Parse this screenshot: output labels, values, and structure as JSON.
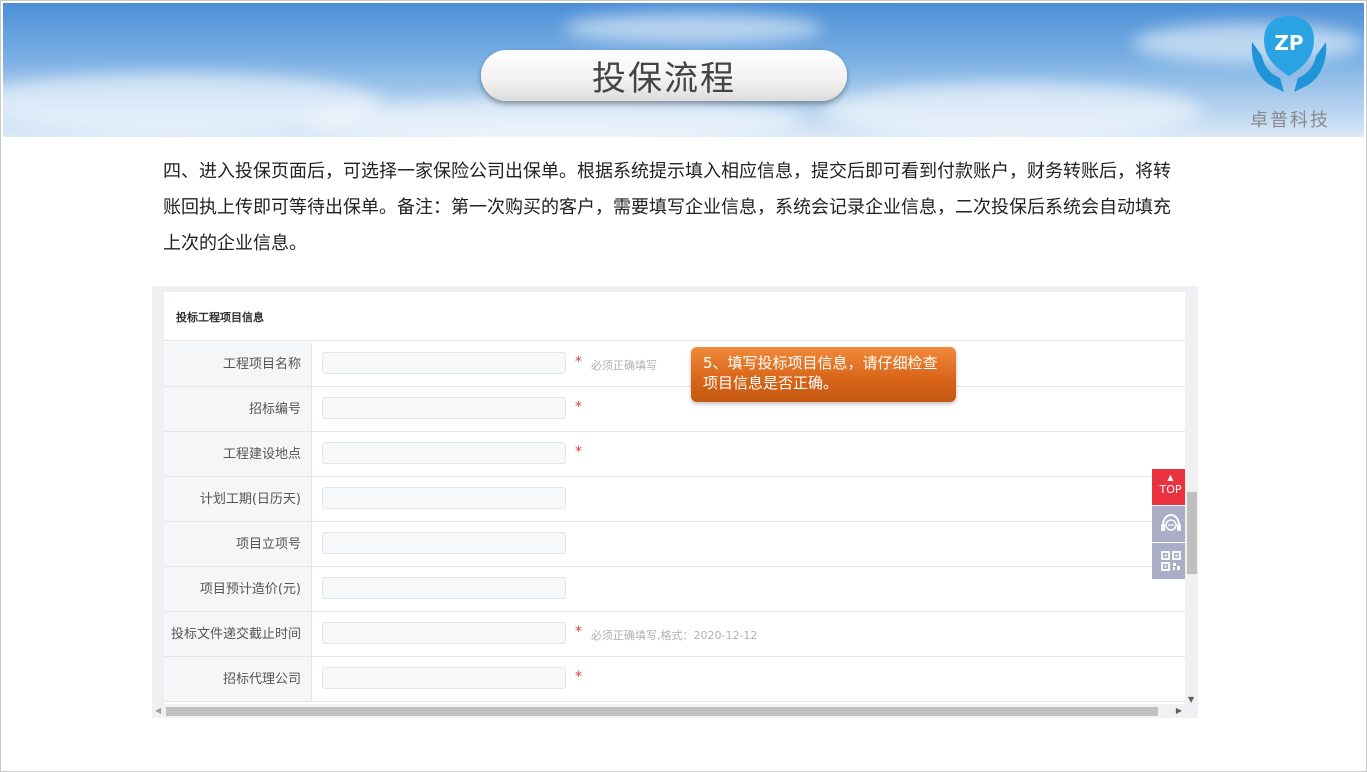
{
  "slide": {
    "title": "投保流程",
    "logo_text": "卓普科技",
    "paragraph": "四、进入投保页面后，可选择一家保险公司出保单。根据系统提示填入相应信息，提交后即可看到付款账户，财务转账后，将转账回执上传即可等待出保单。备注：第一次购买的客户，需要填写企业信息，系统会记录企业信息，二次投保后系统会自动填充上次的企业信息。"
  },
  "form": {
    "section_title": "投标工程项目信息",
    "required_mark": "*",
    "rows": [
      {
        "label": "工程项目名称",
        "value": "",
        "hint": "必须正确填写"
      },
      {
        "label": "招标编号",
        "value": "",
        "hint": ""
      },
      {
        "label": "工程建设地点",
        "value": "",
        "hint": ""
      },
      {
        "label": "计划工期(日历天)",
        "value": "",
        "hint": ""
      },
      {
        "label": "项目立项号",
        "value": "",
        "hint": ""
      },
      {
        "label": "项目预计造价(元)",
        "value": "",
        "hint": ""
      },
      {
        "label": "投标文件递交截止时间",
        "value": "",
        "hint": "必须正确填写,格式：2020-12-12"
      },
      {
        "label": "招标代理公司",
        "value": "",
        "hint": ""
      }
    ]
  },
  "tooltip": {
    "text": "5、填写投标项目信息，请仔细检查项目信息是否正确。"
  },
  "float_bar": {
    "top_label": "TOP",
    "icons": [
      "customer-service-icon",
      "qr-code-icon"
    ]
  },
  "colors": {
    "accent_red": "#e8323f",
    "tooltip_orange": "#d86418",
    "required_red": "#e23b3b"
  }
}
